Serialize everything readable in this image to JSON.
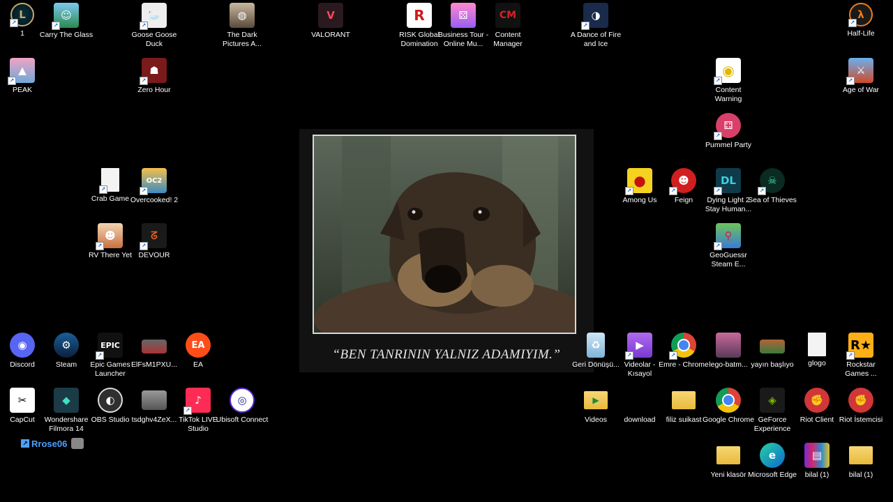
{
  "colors": {
    "desktop_bg": "#000000",
    "shortcut_arrow": "#1a6fd6",
    "user_text": "#4da0ff"
  },
  "wallpaper": {
    "caption": "“BEN TANRININ YALNIZ ADAMIYIM.”"
  },
  "user_tag": {
    "name": "Rrose06"
  },
  "icons": {
    "lol": "1",
    "carry": "Carry The Glass",
    "goose": "Goose Goose Duck",
    "darkpictures": "The Dark Pictures A...",
    "valorant": "VALORANT",
    "risk": "RISK Global Domination",
    "businesstour": "Business Tour - Online Mu...",
    "contentmanager": "Content Manager",
    "adance": "A Dance of Fire and Ice",
    "halflife": "Half-Life",
    "peak": "PEAK",
    "zerohour": "Zero Hour",
    "contentwarning": "Content Warning",
    "ageofwar": "Age of War",
    "pummel": "Pummel Party",
    "crabgame": "Crab Game",
    "overcooked": "Overcooked! 2",
    "amongus": "Among Us",
    "feign": "Feign",
    "dyinglight": "Dying Light 2 Stay Human...",
    "seaofthieves": "Sea of Thieves",
    "rvthereyet": "RV There Yet",
    "devour": "DEVOUR",
    "geoguessr": "GeoGuessr Steam E...",
    "discord": "Discord",
    "steam": "Steam",
    "epic": "Epic Games Launcher",
    "elfs": "ElFsM1PXU...",
    "ea": "EA",
    "recycle": "Geri Dönüşü...",
    "videolar": "Videolar - Kısayol",
    "emre": "Emre - Chrome",
    "lego": "lego-batm...",
    "yayin": "yayın başlıyo",
    "glogo": "glogo",
    "rockstar": "Rockstar Games ...",
    "capcut": "CapCut",
    "filmora": "Wondershare Filmora 14",
    "obs": "OBS Studio",
    "tsdg": "tsdghv4ZeX...",
    "tiktok": "TikTok LIVE Studio",
    "ubisoft": "Ubisoft Connect",
    "videos": "Videos",
    "download": "download",
    "filiz": "filiz suikast",
    "chrome": "Google Chrome",
    "geforce": "GeForce Experience",
    "riotclient": "Riot Client",
    "riotistemci": "Riot İstemcisi",
    "yeniklasor": "Yeni klasör",
    "edge": "Microsoft Edge",
    "bilal1": "bilal (1)",
    "bilal2": "bilal (1)"
  }
}
